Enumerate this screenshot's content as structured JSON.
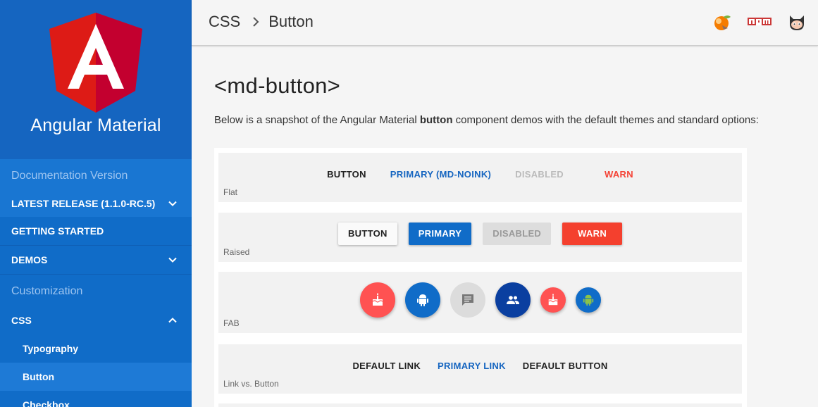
{
  "sidebar": {
    "brand_title": "Angular Material",
    "section_documentation": "Documentation Version",
    "latest_release": "LATEST RELEASE (1.1.0-RC.5)",
    "getting_started": "GETTING STARTED",
    "demos": "DEMOS",
    "section_customization": "Customization",
    "css": "CSS",
    "sub_items": [
      "Typography",
      "Button",
      "Checkbox"
    ]
  },
  "header": {
    "crumb_parent": "CSS",
    "crumb_current": "Button",
    "icons": [
      "codepen-icon",
      "npm-icon",
      "github-icon"
    ]
  },
  "main": {
    "title": "<md-button>",
    "intro_before": "Below is a snapshot of the Angular Material ",
    "intro_bold": "button",
    "intro_after": " component demos with the default themes and standard options:"
  },
  "demos": {
    "flat": {
      "label": "Flat",
      "buttons": [
        "BUTTON",
        "PRIMARY (MD-NOINK)",
        "DISABLED",
        "WARN"
      ]
    },
    "raised": {
      "label": "Raised",
      "buttons": [
        "BUTTON",
        "PRIMARY",
        "DISABLED",
        "WARN"
      ]
    },
    "fab": {
      "label": "FAB",
      "icons": [
        "cake-icon",
        "android-icon",
        "comment-icon",
        "people-icon",
        "cake-icon",
        "android-icon"
      ]
    },
    "links": {
      "label": "Link vs. Button",
      "buttons": [
        "DEFAULT LINK",
        "PRIMARY LINK",
        "DEFAULT BUTTON"
      ]
    }
  },
  "colors": {
    "sidebar": "#106cc8",
    "primary": "#106cc8",
    "warn": "#f44336",
    "fab_red": "#ff5252",
    "fab_blue": "#106cc8",
    "fab_dark_blue": "#0a3fa0",
    "android_green": "#8bc34a"
  }
}
